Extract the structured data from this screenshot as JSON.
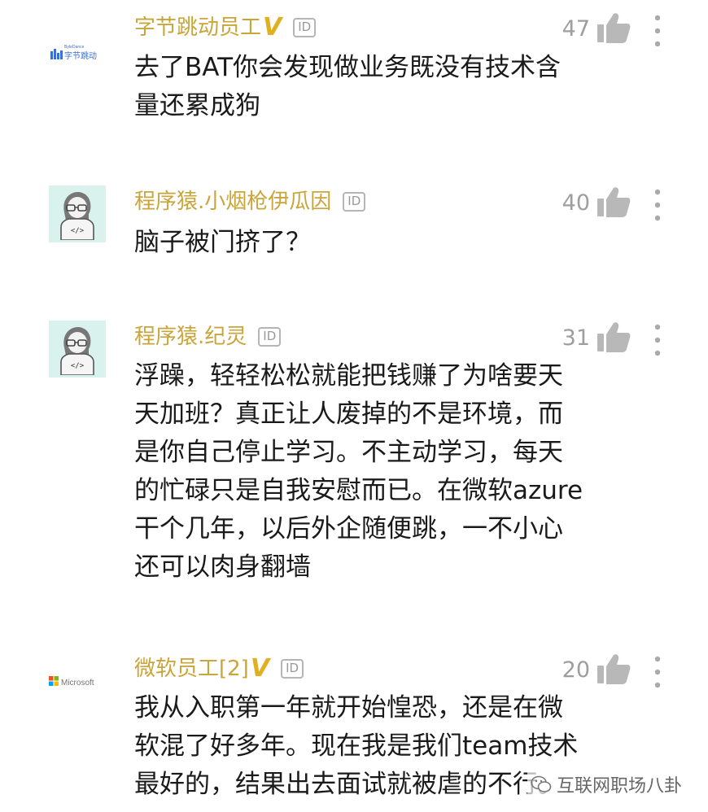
{
  "comments": [
    {
      "username": "字节跳动员工",
      "verified": true,
      "id_badge": "ID",
      "likes": "47",
      "avatar": {
        "type": "logo",
        "text": "字节跳动",
        "small_text": "ByteDance"
      },
      "text": "去了BAT你会发现做业务既没有技术含\n量还累成狗"
    },
    {
      "username": "程序猿.小烟枪伊瓜因",
      "verified": false,
      "id_badge": "ID",
      "likes": "40",
      "avatar": {
        "type": "coder",
        "text": "</>"
      },
      "text": "脑子被门挤了？"
    },
    {
      "username": "程序猿.纪灵",
      "verified": false,
      "id_badge": "ID",
      "likes": "31",
      "avatar": {
        "type": "coder",
        "text": "</>"
      },
      "text": "浮躁，轻轻松松就能把钱赚了为啥要天\n天加班？真正让人废掉的不是环境，而\n是你自己停止学习。不主动学习，每天\n的忙碌只是自我安慰而已。在微软azure\n干个几年，以后外企随便跳，一不小心\n还可以肉身翻墙"
    },
    {
      "username": "微软员工[2]",
      "verified": true,
      "id_badge": "ID",
      "likes": "20",
      "avatar": {
        "type": "logo",
        "text": "Microsoft"
      },
      "text": "我从入职第一年就开始惶恐，还是在微\n软混了好多年。现在我是我们team技术\n最好的，结果出去面试就被虐的不行。"
    }
  ],
  "watermark": "互联网职场八卦",
  "colors": {
    "username": "#c9a53a",
    "verified": "#e0b020",
    "likes": "#9e9e9e",
    "avatar_bg": "#d9f2ee"
  }
}
